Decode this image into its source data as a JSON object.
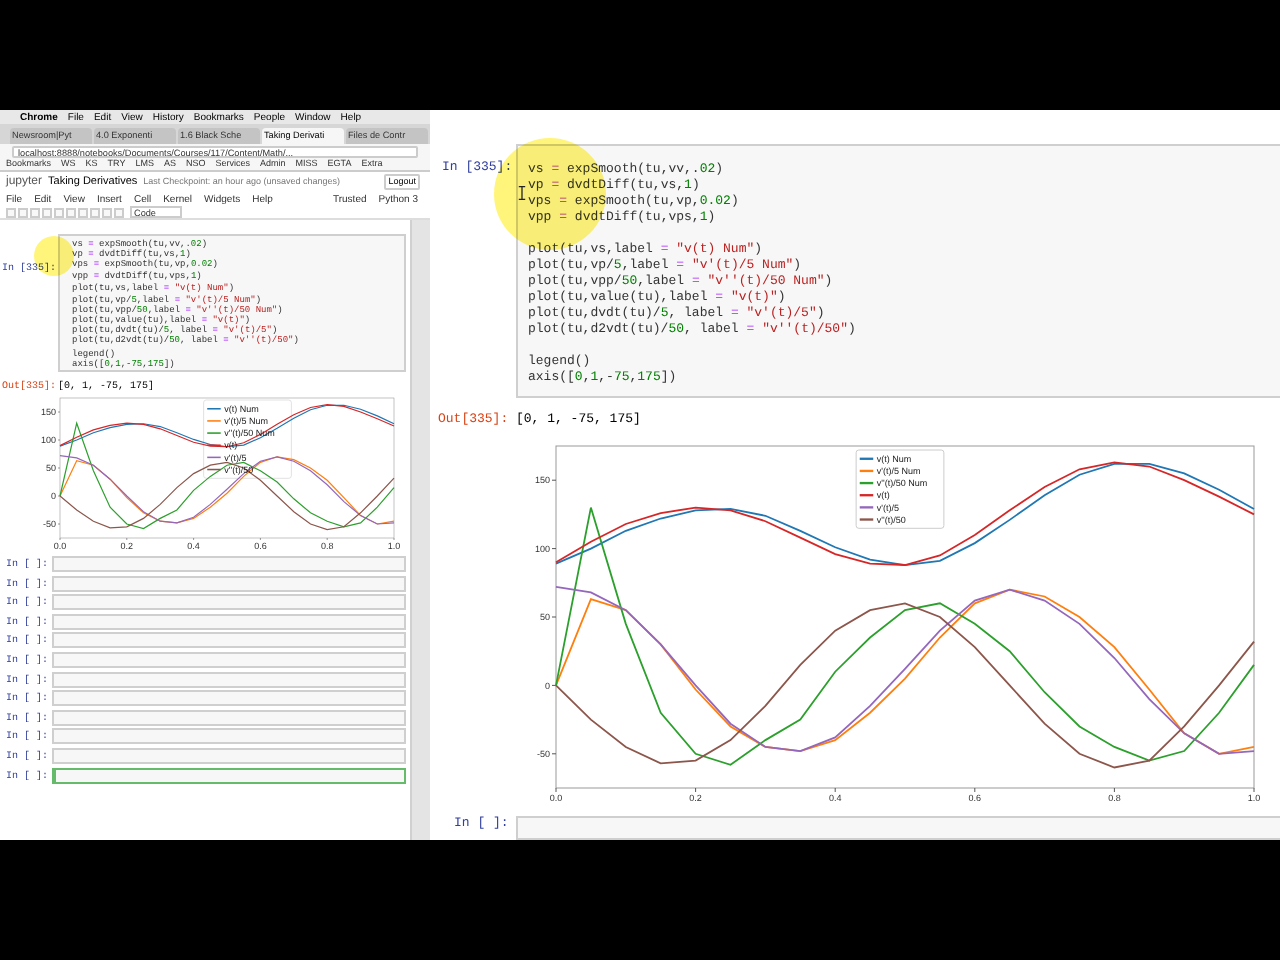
{
  "left_browser": {
    "menu_bar": [
      "Chrome",
      "File",
      "Edit",
      "View",
      "History",
      "Bookmarks",
      "People",
      "Window",
      "Help"
    ],
    "tabs": [
      {
        "label": "Newsroom|Pyt",
        "selected": false
      },
      {
        "label": "4.0 Exponenti",
        "selected": false
      },
      {
        "label": "1.6 Black Sche",
        "selected": false
      },
      {
        "label": "Taking Derivati",
        "selected": true
      },
      {
        "label": "Files de Contr",
        "selected": false
      }
    ],
    "address": "localhost:8888/notebooks/Documents/Courses/117/Content/Math/...",
    "bookmarks": [
      "Bookmarks",
      "WS",
      "KS",
      "TRY",
      "LMS",
      "AS",
      "NSO",
      "Services",
      "Admin",
      "MISS",
      "EGTA",
      "Extra"
    ],
    "notebook": {
      "logo": "jupyter",
      "title": "Taking Derivatives",
      "checkpoint": "Last Checkpoint: an hour ago (unsaved changes)",
      "logout": "Logout",
      "menu": [
        "File",
        "Edit",
        "View",
        "Insert",
        "Cell",
        "Kernel",
        "Widgets",
        "Help"
      ],
      "trusted": "Trusted",
      "kernel": "Python 3",
      "cell_type": "Code",
      "code_cell": {
        "prompt": "In [335]:",
        "groups": [
          [
            "vs = expSmooth(tu,vv,.02)",
            "vp = dvdtDiff(tu,vs,1)",
            "vps = expSmooth(tu,vp,0.02)",
            "vpp = dvdtDiff(tu,vps,1)"
          ],
          [
            "plot(tu,vs,label = \"v(t) Num\")",
            "plot(tu,vp/5,label = \"v'(t)/5 Num\")",
            "plot(tu,vpp/50,label = \"v''(t)/50 Num\")",
            "plot(tu,value(tu),label = \"v(t)\")",
            "plot(tu,dvdt(tu)/5, label = \"v'(t)/5\")",
            "plot(tu,d2vdt(tu)/50, label = \"v''(t)/50\")"
          ],
          [
            "legend()",
            "axis([0,1,-75,175])"
          ]
        ]
      },
      "output": {
        "prompt": "Out[335]:",
        "text": "[0, 1, -75, 175]"
      },
      "chart_data": {
        "type": "line",
        "legend": "upper center",
        "x": [
          0,
          0.05,
          0.1,
          0.15,
          0.2,
          0.25,
          0.3,
          0.35,
          0.4,
          0.45,
          0.5,
          0.55,
          0.6,
          0.65,
          0.7,
          0.75,
          0.8,
          0.85,
          0.9,
          0.95,
          1
        ],
        "xlim": [
          0,
          1
        ],
        "ylim": [
          -75,
          175
        ],
        "xticks": [
          {
            "value": 0,
            "label": "0.0"
          },
          {
            "value": 0.2,
            "label": "0.2"
          },
          {
            "value": 0.4,
            "label": "0.4"
          },
          {
            "value": 0.6,
            "label": "0.6"
          },
          {
            "value": 0.8,
            "label": "0.8"
          },
          {
            "value": 1,
            "label": "1.0"
          }
        ],
        "yticks": [
          -50,
          0,
          50,
          100,
          150
        ],
        "series": [
          {
            "name": "v(t) Num",
            "color": "#1f77b4",
            "values": [
              89,
              100,
              113,
              122,
              128,
              129,
              124,
              113,
              101,
              92,
              88,
              91,
              104,
              121,
              139,
              154,
              162,
              162,
              155,
              143,
              129
            ]
          },
          {
            "name": "v'(t)/5 Num",
            "color": "#ff7f0e",
            "values": [
              0,
              63,
              55,
              30,
              -3,
              -30,
              -45,
              -48,
              -40,
              -20,
              5,
              35,
              60,
              70,
              65,
              50,
              28,
              -3,
              -35,
              -50,
              -45
            ]
          },
          {
            "name": "v''(t)/50 Num",
            "color": "#2ca02c",
            "values": [
              0,
              130,
              45,
              -20,
              -50,
              -58,
              -40,
              -25,
              10,
              35,
              55,
              60,
              45,
              25,
              -5,
              -30,
              -45,
              -55,
              -48,
              -20,
              15
            ]
          },
          {
            "name": "v(t)",
            "color": "#d62728",
            "values": [
              90,
              105,
              118,
              126,
              130,
              128,
              120,
              108,
              96,
              89,
              88,
              95,
              110,
              128,
              145,
              158,
              163,
              160,
              150,
              138,
              125
            ]
          },
          {
            "name": "v'(t)/5",
            "color": "#9467bd",
            "values": [
              72,
              68,
              55,
              30,
              0,
              -28,
              -45,
              -48,
              -38,
              -15,
              12,
              40,
              62,
              70,
              62,
              45,
              20,
              -10,
              -35,
              -50,
              -48
            ]
          },
          {
            "name": "v''(t)/50",
            "color": "#8c564b",
            "values": [
              0,
              -25,
              -45,
              -57,
              -55,
              -40,
              -15,
              15,
              40,
              55,
              60,
              50,
              28,
              0,
              -28,
              -50,
              -60,
              -55,
              -30,
              0,
              32
            ]
          }
        ]
      },
      "empty_cells": [
        {
          "prompt": "In [ ]:",
          "selected": false
        },
        {
          "prompt": "In [ ]:",
          "selected": false
        },
        {
          "prompt": "In [ ]:",
          "selected": false
        },
        {
          "prompt": "In [ ]:",
          "selected": false
        },
        {
          "prompt": "In [ ]:",
          "selected": false
        },
        {
          "prompt": "In [ ]:",
          "selected": false
        },
        {
          "prompt": "In [ ]:",
          "selected": false
        },
        {
          "prompt": "In [ ]:",
          "selected": false
        },
        {
          "prompt": "In [ ]:",
          "selected": false
        },
        {
          "prompt": "In [ ]:",
          "selected": false
        },
        {
          "prompt": "In [ ]:",
          "selected": false
        },
        {
          "prompt": "In [ ]:",
          "selected": true
        }
      ]
    }
  },
  "zoomed_notebook": {
    "code_cell": {
      "prompt": "In [335]:",
      "groups": [
        [
          "vs = expSmooth(tu,vv,.02)",
          "vp = dvdtDiff(tu,vs,1)",
          "vps = expSmooth(tu,vp,0.02)",
          "vpp = dvdtDiff(tu,vps,1)"
        ],
        [
          "plot(tu,vs,label = \"v(t) Num\")",
          "plot(tu,vp/5,label = \"v'(t)/5 Num\")",
          "plot(tu,vpp/50,label = \"v''(t)/50 Num\")",
          "plot(tu,value(tu),label = \"v(t)\")",
          "plot(tu,dvdt(tu)/5, label = \"v'(t)/5\")",
          "plot(tu,d2vdt(tu)/50, label = \"v''(t)/50\")"
        ],
        [
          "legend()",
          "axis([0,1,-75,175])"
        ]
      ]
    },
    "output": {
      "prompt": "Out[335]:",
      "text": "[0, 1, -75, 175]"
    },
    "chart_data": {
      "type": "line",
      "legend": "upper center",
      "x": [
        0,
        0.05,
        0.1,
        0.15,
        0.2,
        0.25,
        0.3,
        0.35,
        0.4,
        0.45,
        0.5,
        0.55,
        0.6,
        0.65,
        0.7,
        0.75,
        0.8,
        0.85,
        0.9,
        0.95,
        1
      ],
      "xlim": [
        0,
        1
      ],
      "ylim": [
        -75,
        175
      ],
      "xticks": [
        {
          "value": 0,
          "label": "0.0"
        },
        {
          "value": 0.2,
          "label": "0.2"
        },
        {
          "value": 0.4,
          "label": "0.4"
        },
        {
          "value": 0.6,
          "label": "0.6"
        },
        {
          "value": 0.8,
          "label": "0.8"
        },
        {
          "value": 1,
          "label": "1.0"
        }
      ],
      "yticks": [
        -50,
        0,
        50,
        100,
        150
      ],
      "series": [
        {
          "name": "v(t) Num",
          "color": "#1f77b4",
          "values": [
            89,
            100,
            113,
            122,
            128,
            129,
            124,
            113,
            101,
            92,
            88,
            91,
            104,
            121,
            139,
            154,
            162,
            162,
            155,
            143,
            129
          ]
        },
        {
          "name": "v'(t)/5 Num",
          "color": "#ff7f0e",
          "values": [
            0,
            63,
            55,
            30,
            -3,
            -30,
            -45,
            -48,
            -40,
            -20,
            5,
            35,
            60,
            70,
            65,
            50,
            28,
            -3,
            -35,
            -50,
            -45
          ]
        },
        {
          "name": "v''(t)/50 Num",
          "color": "#2ca02c",
          "values": [
            0,
            130,
            45,
            -20,
            -50,
            -58,
            -40,
            -25,
            10,
            35,
            55,
            60,
            45,
            25,
            -5,
            -30,
            -45,
            -55,
            -48,
            -20,
            15
          ]
        },
        {
          "name": "v(t)",
          "color": "#d62728",
          "values": [
            90,
            105,
            118,
            126,
            130,
            128,
            120,
            108,
            96,
            89,
            88,
            95,
            110,
            128,
            145,
            158,
            163,
            160,
            150,
            138,
            125
          ]
        },
        {
          "name": "v'(t)/5",
          "color": "#9467bd",
          "values": [
            72,
            68,
            55,
            30,
            0,
            -28,
            -45,
            -48,
            -38,
            -15,
            12,
            40,
            62,
            70,
            62,
            45,
            20,
            -10,
            -35,
            -50,
            -48
          ]
        },
        {
          "name": "v''(t)/50",
          "color": "#8c564b",
          "values": [
            0,
            -25,
            -45,
            -57,
            -55,
            -40,
            -15,
            15,
            40,
            55,
            60,
            50,
            28,
            0,
            -28,
            -50,
            -60,
            -55,
            -30,
            0,
            32
          ]
        }
      ]
    },
    "next_cell_prompt": "In [ ]:"
  }
}
